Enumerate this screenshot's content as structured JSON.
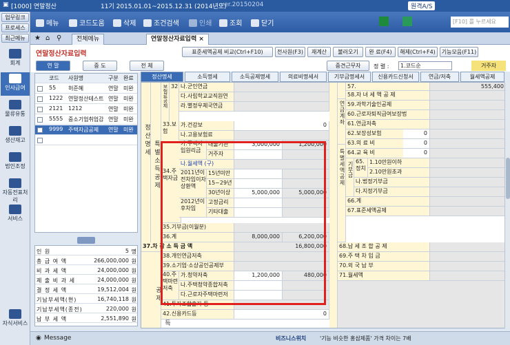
{
  "titlebar": {
    "code": "[1000] 연말정산",
    "period": "11기 2015.01.01~2015.12.31 (2014년도)",
    "version": "ver.20150204",
    "remote": "원격A/S",
    "search": "[F10] 를 누르세요"
  },
  "left_sidebar": {
    "top_buttons": [
      "업무링크",
      "프로세스",
      "최근메뉴"
    ],
    "nav": [
      "회계",
      "인사급여",
      "물류유통",
      "생산재고",
      "법인조정",
      "자동전표처리",
      "서비스"
    ],
    "active": "인사급여",
    "bottom": "자식서비스"
  },
  "toolbar": {
    "menu": "메뉴",
    "help": "코드도움",
    "delete": "삭제",
    "query": "조건검색",
    "print": "인쇄",
    "find": "조회",
    "close": "닫기"
  },
  "tabs": {
    "all": "전체메뉴",
    "current": "연말정산자료입력"
  },
  "header": {
    "title": "연말정산자료입력",
    "buttons": [
      "표준세액공제 비교(Ctrl+F10)",
      "전사원(F3)",
      "재계산",
      "불러오기",
      "완 료(F4)",
      "해제(Ctrl+F4)",
      "기능모음(F11)"
    ]
  },
  "segment": {
    "opts": [
      "연 말",
      "중 도",
      "전 체"
    ],
    "calc_btn": "중견근무자",
    "sort_label": "정 렬 :",
    "sort_value": "1.코드순",
    "resident": "거주자"
  },
  "left_grid": {
    "headers": [
      "코드",
      "사원명",
      "구분",
      "완료"
    ],
    "rows": [
      [
        "55",
        "허준혜",
        "연말",
        "미완"
      ],
      [
        "1222",
        "연말정산테스트",
        "연말",
        "미완"
      ],
      [
        "2121",
        "1212",
        "연말",
        "미완"
      ],
      [
        "5555",
        "중소기업취업감",
        "연말",
        "미완"
      ],
      [
        "9999",
        "주택자금공제",
        "연말",
        "미완"
      ]
    ]
  },
  "left_summary": {
    "rows": [
      [
        "인 원",
        "5",
        "명"
      ],
      [
        "총 급 여 액",
        "266,000,000",
        "원"
      ],
      [
        "비 과 세 액",
        "24,000,000",
        "원"
      ],
      [
        "제 출 비 과 세",
        "24,000,000",
        "원"
      ],
      [
        "결 정 세 액",
        "19,512,004",
        "원"
      ],
      [
        "기납부세액(현)",
        "16,740,118",
        "원"
      ],
      [
        "기납부세액(종전)",
        "220,000",
        "원"
      ],
      [
        "납 부 세 액",
        "2,551,890",
        "원"
      ]
    ]
  },
  "right_tabs": [
    "정산명세",
    "소득명세",
    "소득공제명세",
    "의료비명세서",
    "기부금명세서",
    "신용카드신청서",
    "연금/저축",
    "월세액공제"
  ],
  "form": {
    "vlabels": {
      "tax_ded": "정산명세",
      "special": "특별소득공제",
      "other": "그밖의소득공제",
      "ins": "보험료공제",
      "housing_s": "주택자금",
      "t_yeon": "연금계좌",
      "t_special": "특별세액공제",
      "t_gibu": "기부금"
    },
    "rows_left": [
      {
        "no": "32",
        "label": "나.군인연금"
      },
      {
        "label": "다.사립학교교직원연"
      },
      {
        "label": "라.별정우체국연금"
      },
      {
        "no": "33.보험",
        "label": "가.건강보",
        "val": "0"
      },
      {
        "label": "나.고용보험료",
        "val": ""
      }
    ],
    "housing": {
      "no": "34.주택자금",
      "g1": "가.주택자입원리금",
      "r1": "대출기관",
      "r1v1": "3,000,000",
      "r1v2": "1,200,000",
      "r2": "거주자",
      "wol": "나.월세액 (구)",
      "g2": "2011년이전차입이자상환액",
      "r3": "15년미만",
      "r4": "15~29년",
      "r5": "30년이상",
      "r5v1": "5,000,000",
      "r5v2": "5,000,000",
      "g3": "2012년이후차입",
      "r6": "고정금리",
      "r7": "기타대출",
      "gibu": "35.기부금(이월분)",
      "total": "36.계",
      "tv1": "8,000,000",
      "tv2": "6,200,000"
    },
    "income": {
      "label": "37.차 감 소 득 금 액",
      "val": "16,800,000"
    },
    "rows_other": [
      {
        "label": "38.개인연금저축"
      },
      {
        "label": "39.소기업·소상공인공제부"
      },
      {
        "no": "40.주택마련저축",
        "label": "가.청약저축",
        "v1": "1,200,000",
        "v2": "480,000"
      },
      {
        "label": "나.주택청약종합저축"
      },
      {
        "label": "다.근로자주택마련저"
      },
      {
        "label": "41.투자조합출자 등"
      },
      {
        "label": "42.신용카드등",
        "val": "0"
      }
    ],
    "right_rows": [
      "57.",
      "58.자 녀 세 액 공 제",
      "59.과학기술인공제",
      "60.근로자퇴직급여보장법",
      "61.연금저축",
      "62.보장성보험",
      "63.의 료 비",
      "64.교 육 비",
      "65.정치",
      "1.10만원이하",
      "2.10만원초과",
      "나.법정기부금",
      "다.지정기부금",
      "66.계",
      "67.표준세액공제",
      "68.납 세 조 합 공 제",
      "69.주 택 차 입 금",
      "70.외 국 납 부",
      "71.월세액"
    ],
    "right_vals": {
      "r62": "0",
      "r63": "0",
      "r64": "0",
      "top": "555,400"
    }
  },
  "status": {
    "message": "Message",
    "ticker_brand": "비즈니스위치",
    "ticker": "'기능 비슷한 홍삼제품' 가격 차이는 7배"
  }
}
